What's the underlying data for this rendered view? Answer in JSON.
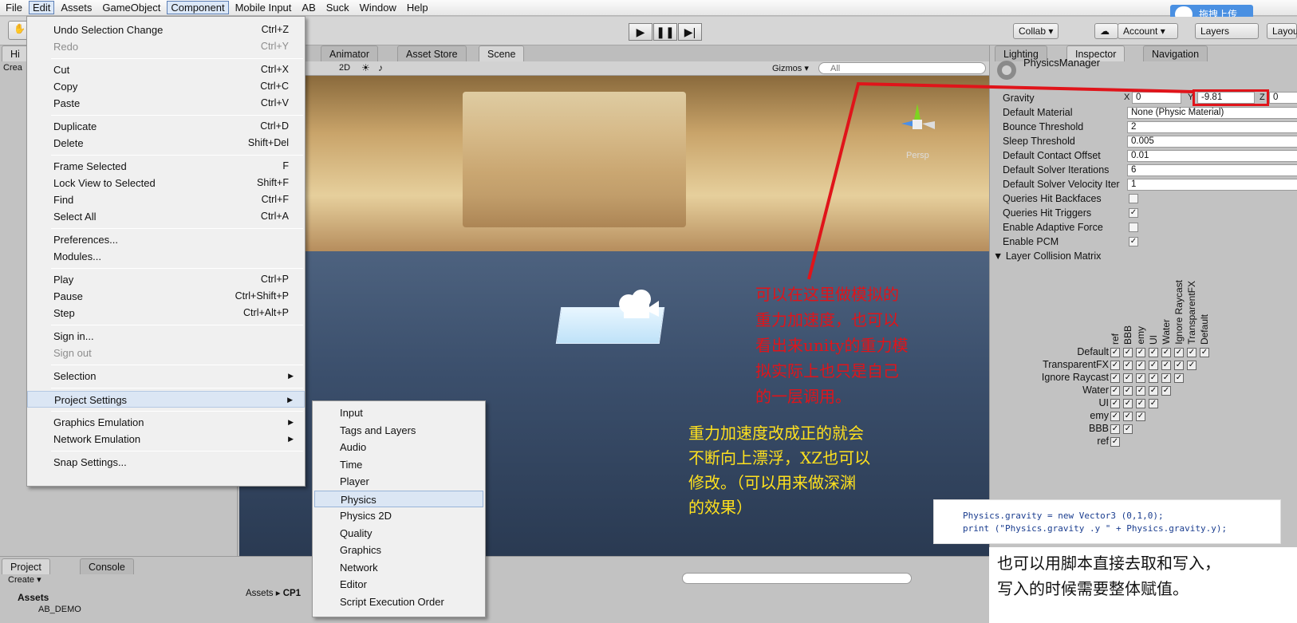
{
  "menubar": {
    "items": [
      "File",
      "Edit",
      "Assets",
      "GameObject",
      "Component",
      "Mobile Input",
      "AB",
      "Suck",
      "Window",
      "Help"
    ]
  },
  "toolbar": {
    "collab": "Collab ▾",
    "account": "Account ▾",
    "layers": "Layers",
    "layout": "Layou"
  },
  "upload_badge": "拖拽上传",
  "hierarchy": {
    "tab": "Hi",
    "create": "Crea"
  },
  "scene": {
    "tabs": [
      "Animator",
      "Asset Store",
      "Scene"
    ],
    "mode_2d": "2D",
    "gizmos": "Gizmos ▾",
    "search_placeholder": "All",
    "persp": "Persp"
  },
  "edit_menu": {
    "items": [
      {
        "label": "Undo Selection Change",
        "shortcut": "Ctrl+Z"
      },
      {
        "label": "Redo",
        "shortcut": "Ctrl+Y"
      },
      {
        "label": "Cut",
        "shortcut": "Ctrl+X"
      },
      {
        "label": "Copy",
        "shortcut": "Ctrl+C"
      },
      {
        "label": "Paste",
        "shortcut": "Ctrl+V"
      },
      {
        "label": "Duplicate",
        "shortcut": "Ctrl+D"
      },
      {
        "label": "Delete",
        "shortcut": "Shift+Del"
      },
      {
        "label": "Frame Selected",
        "shortcut": "F"
      },
      {
        "label": "Lock View to Selected",
        "shortcut": "Shift+F"
      },
      {
        "label": "Find",
        "shortcut": "Ctrl+F"
      },
      {
        "label": "Select All",
        "shortcut": "Ctrl+A"
      },
      {
        "label": "Preferences...",
        "shortcut": ""
      },
      {
        "label": "Modules...",
        "shortcut": ""
      },
      {
        "label": "Play",
        "shortcut": "Ctrl+P"
      },
      {
        "label": "Pause",
        "shortcut": "Ctrl+Shift+P"
      },
      {
        "label": "Step",
        "shortcut": "Ctrl+Alt+P"
      },
      {
        "label": "Sign in...",
        "shortcut": ""
      },
      {
        "label": "Sign out",
        "shortcut": ""
      },
      {
        "label": "Selection",
        "shortcut": ""
      },
      {
        "label": "Project Settings",
        "shortcut": ""
      },
      {
        "label": "Graphics Emulation",
        "shortcut": ""
      },
      {
        "label": "Network Emulation",
        "shortcut": ""
      },
      {
        "label": "Snap Settings...",
        "shortcut": ""
      }
    ]
  },
  "project_settings_menu": {
    "items": [
      "Input",
      "Tags and Layers",
      "Audio",
      "Time",
      "Player",
      "Physics",
      "Physics 2D",
      "Quality",
      "Graphics",
      "Network",
      "Editor",
      "Script Execution Order"
    ]
  },
  "inspector": {
    "tabs": [
      "Lighting",
      "Inspector",
      "Navigation"
    ],
    "title": "PhysicsManager",
    "gravity": {
      "label": "Gravity",
      "x_label": "X",
      "x": "0",
      "y_label": "Y",
      "y": "-9.81",
      "z_label": "Z",
      "z": "0"
    },
    "fields": [
      {
        "label": "Default Material",
        "value": "None (Physic Material)"
      },
      {
        "label": "Bounce Threshold",
        "value": "2"
      },
      {
        "label": "Sleep Threshold",
        "value": "0.005"
      },
      {
        "label": "Default Contact Offset",
        "value": "0.01"
      },
      {
        "label": "Default Solver Iterations",
        "value": "6"
      },
      {
        "label": "Default Solver Velocity Iter",
        "value": "1"
      }
    ],
    "checks": [
      {
        "label": "Queries Hit Backfaces",
        "checked": false
      },
      {
        "label": "Queries Hit Triggers",
        "checked": true
      },
      {
        "label": "Enable Adaptive Force",
        "checked": false
      },
      {
        "label": "Enable PCM",
        "checked": true
      }
    ],
    "matrix_title": "Layer Collision Matrix",
    "matrix_layers": [
      "Default",
      "TransparentFX",
      "Ignore Raycast",
      "Water",
      "UI",
      "emy",
      "BBB",
      "ref"
    ]
  },
  "annotations": {
    "red_lines": [
      "可以在这里做模拟的",
      "重力加速度，也可以",
      "看出来unity的重力模",
      "拟实际上也只是自己",
      "的一层调用。"
    ],
    "yellow_lines": [
      "重力加速度改成正的就会",
      "不断向上漂浮，XZ也可以",
      "修改。（可以用来做深渊",
      "的效果）"
    ],
    "code_line1": "Physics.gravity = new Vector3 (0,1,0);",
    "code_line2": "print (\"Physics.gravity .y \" + Physics.gravity.y);",
    "bottom_lines": [
      "也可以用脚本直接去取和写入，",
      "写入的时候需要整体赋值。"
    ]
  },
  "project": {
    "tabs": [
      "Project",
      "Console"
    ],
    "create": "Create ▾",
    "assets": "Assets",
    "ab_demo": "AB_DEMO",
    "breadcrumb_root": "Assets",
    "breadcrumb_child": "CP1"
  },
  "colors": {
    "annotation_red": "#e0141a",
    "annotation_yellow": "#ffe11e",
    "menu_highlight": "#dbe6f4"
  }
}
